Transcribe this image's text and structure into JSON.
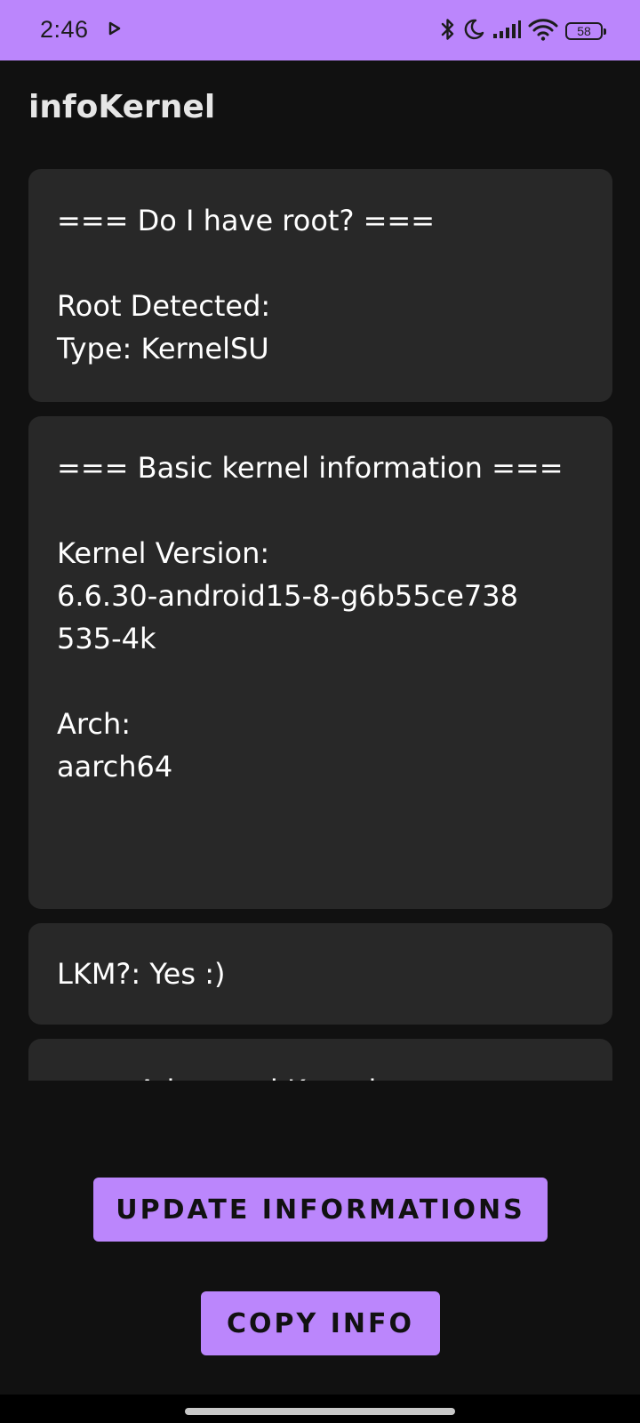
{
  "status_bar": {
    "time": "2:46",
    "battery": "58",
    "icons": [
      "play-icon",
      "bluetooth-icon",
      "moon-icon",
      "signal-icon",
      "wifi-icon",
      "battery-icon"
    ]
  },
  "app": {
    "title": "infoKernel"
  },
  "cards": {
    "root": {
      "heading": "=== Do I have root? ===",
      "line1": "Root Detected:",
      "line2": "Type: KernelSU"
    },
    "kernel": {
      "heading": "=== Basic kernel information ===",
      "version_label": "Kernel Version:",
      "version_line1": "6.6.30-android15-8-g6b55ce738",
      "version_line2": "535-4k",
      "arch_label": "Arch:",
      "arch_value": "aarch64"
    },
    "lkm": {
      "text": "LKM?: Yes :)"
    },
    "advanced": {
      "heading_partial": "=== Advanced Kernel"
    }
  },
  "buttons": {
    "update": "UPDATE INFORMATIONS",
    "copy": "COPY INFO"
  },
  "colors": {
    "accent": "#bb86fc",
    "background": "#111111",
    "card": "#282828"
  }
}
